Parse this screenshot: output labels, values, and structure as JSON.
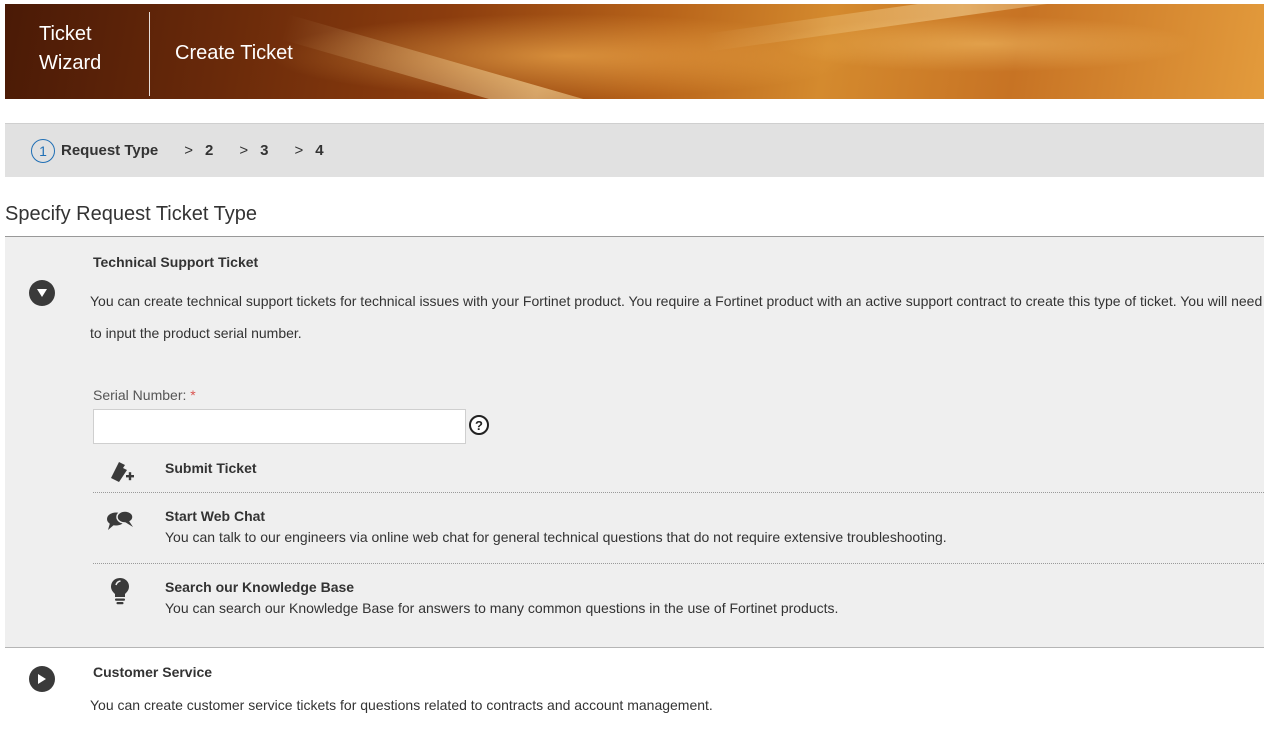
{
  "header": {
    "title": "Ticket Wizard",
    "subtitle": "Create Ticket"
  },
  "steps": {
    "current_number": "1",
    "current_label": "Request Type",
    "separator": ">",
    "others": [
      "2",
      "3",
      "4"
    ]
  },
  "page": {
    "section_title": "Specify Request Ticket Type"
  },
  "technical": {
    "heading": "Technical Support Ticket",
    "description": "You can create technical support tickets for technical issues with your Fortinet product. You require a Fortinet product with an active support contract to create this type of ticket. You will need to input the product serial number.",
    "serial_label": "Serial Number:",
    "required_mark": "*",
    "serial_value": "",
    "help_glyph": "?",
    "actions": [
      {
        "icon": "ticket-add-icon",
        "title": "Submit Ticket",
        "description": ""
      },
      {
        "icon": "chat-bubbles-icon",
        "title": "Start Web Chat",
        "description": "You can talk to our engineers via online web chat for general technical questions that do not require extensive troubleshooting."
      },
      {
        "icon": "lightbulb-icon",
        "title": "Search our Knowledge Base",
        "description": "You can search our Knowledge Base for answers to many common questions in the use of Fortinet products."
      }
    ]
  },
  "customer_service": {
    "heading": "Customer Service",
    "description": "You can create customer service tickets for questions related to contracts and account management."
  },
  "colors": {
    "step_accent": "#1f6fb5",
    "required": "#d9534f",
    "panel_bg": "#efefef",
    "stepbar_bg": "#e1e1e1"
  }
}
